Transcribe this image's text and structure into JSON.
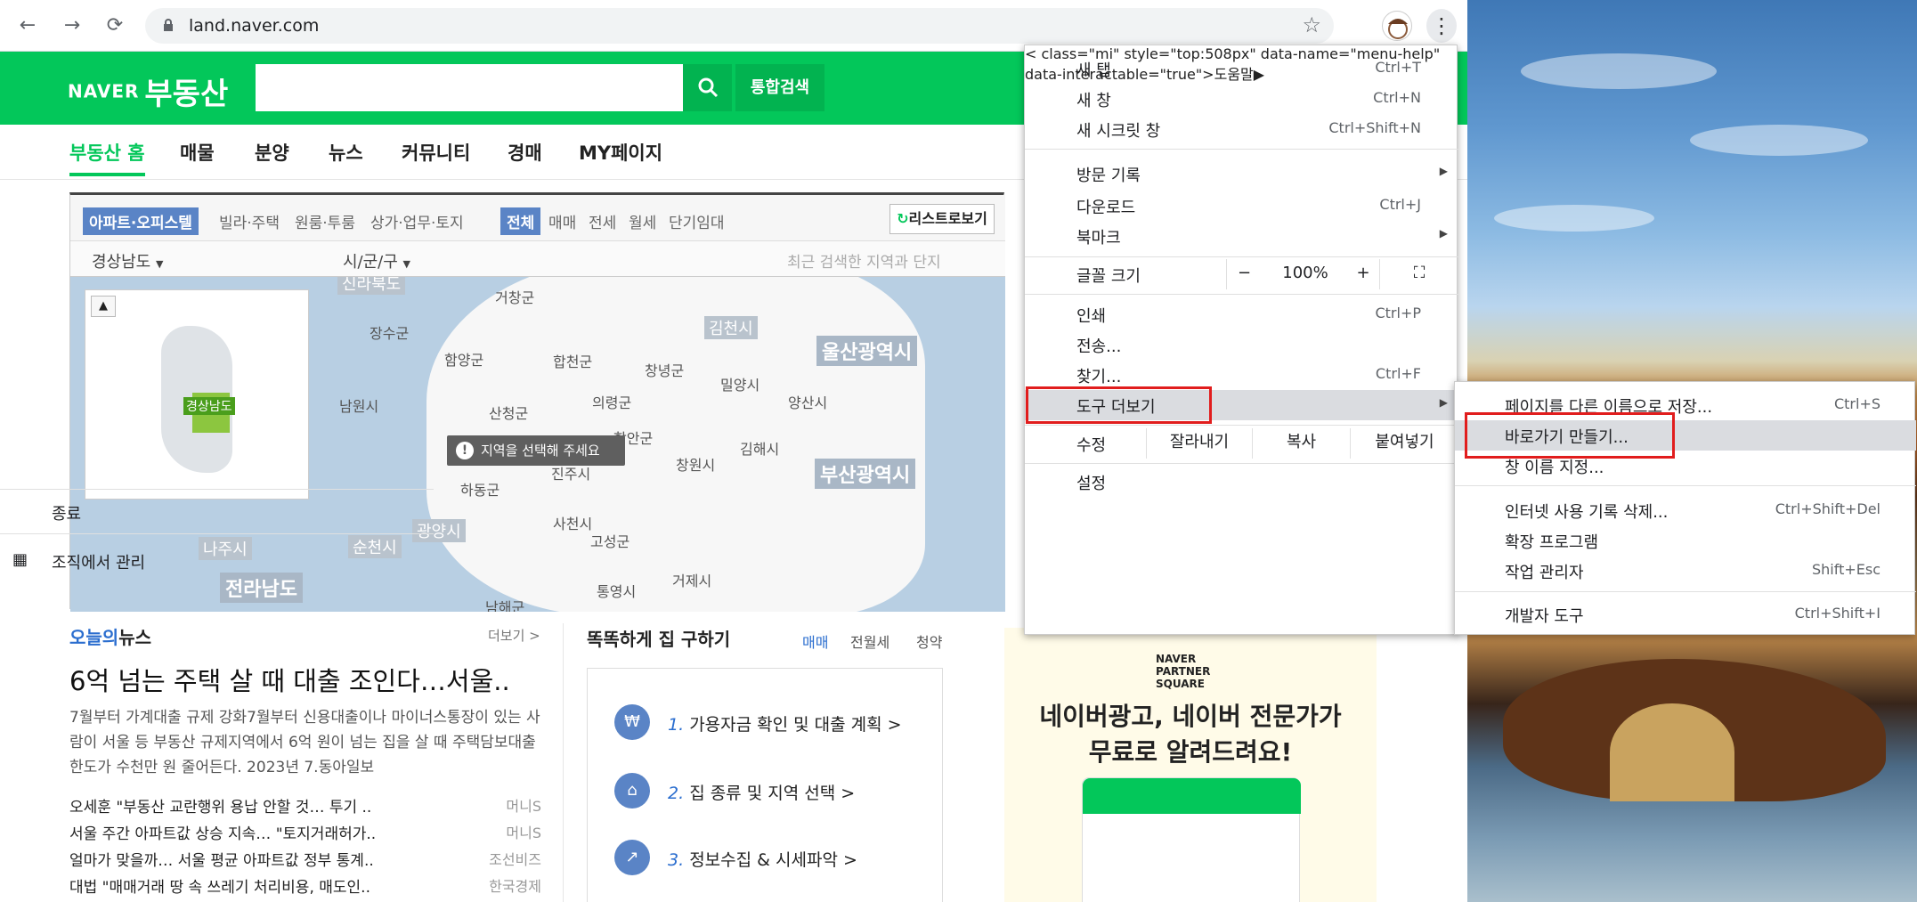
{
  "browser": {
    "url": "land.naver.com",
    "nav_back_icon": "arrow-left-icon",
    "nav_forward_icon": "arrow-right-icon",
    "reload_icon": "reload-icon"
  },
  "naver": {
    "logo_prefix": "NAVER",
    "logo_title": "부동산",
    "search_button": "통합검색",
    "nav": [
      "부동산 홈",
      "매물",
      "분양",
      "뉴스",
      "커뮤니티",
      "경매",
      "MY페이지"
    ]
  },
  "map": {
    "property_tabs": [
      "아파트·오피스텔",
      "빌라·주택",
      "원룸·투룸",
      "상가·업무·토지"
    ],
    "deal_tabs": [
      "전체",
      "매매",
      "전세",
      "월세",
      "단기임대"
    ],
    "list_button": "리스트로보기",
    "region_select": "경상남도",
    "city_select": "시/군/구",
    "recent_placeholder": "최근 검색한 지역과 단지",
    "minimap_tag": "경상남도",
    "notice": "지역을 선택해 주세요",
    "labels": [
      "거창군",
      "장수군",
      "함양군",
      "합천군",
      "창녕군",
      "밀양시",
      "남원시",
      "산청군",
      "의령군",
      "함안군",
      "양산시",
      "김해시",
      "창원시",
      "진주시",
      "하동군",
      "사천시",
      "고성군",
      "나주시",
      "순천시",
      "광양시",
      "통영시",
      "거제시",
      "남해군",
      "김천시"
    ],
    "provinces": [
      "울산광역시",
      "부산광역시",
      "전라남도"
    ],
    "provinces_small": [
      "신라북도"
    ]
  },
  "news": {
    "title_accent": "오늘의",
    "title_rest": "뉴스",
    "more": "더보기 >",
    "headline": "6억 넘는 주택 살 때 대출 조인다…서울..",
    "summary": "7월부터 가계대출 규제 강화7월부터 신용대출이나 마이너스통장이 있는 사람이 서울 등 부동산 규제지역에서 6억 원이 넘는 집을 살 때 주택담보대출 한도가 수천만 원 줄어든다. 2023년 7.동아일보",
    "items": [
      {
        "text": "오세훈 \"부동산 교란행위 용납 안할 것… 투기 ..",
        "source": "머니S"
      },
      {
        "text": "서울 주간 아파트값 상승 지속… \"토지거래허가..",
        "source": "머니S"
      },
      {
        "text": "얼마가 맞을까… 서울 평균 아파트값 정부 통계..",
        "source": "조선비즈"
      },
      {
        "text": "대법 \"매매거래 땅 속 쓰레기 처리비용, 매도인..",
        "source": "한국경제"
      }
    ]
  },
  "house": {
    "title": "똑똑하게 집 구하기",
    "tabs": [
      "매매",
      "전월세",
      "청약"
    ],
    "steps": [
      {
        "num": "1.",
        "text": "가용자금 확인 및 대출 계획 >"
      },
      {
        "num": "2.",
        "text": "집 종류 및 지역 선택 >"
      },
      {
        "num": "3.",
        "text": "정보수집 & 시세파악 >"
      }
    ]
  },
  "ad": {
    "logo": "NAVER PARTNER SQUARE",
    "line1": "네이버광고, 네이버 전문가가",
    "line2": "무료로 알려드려요!"
  },
  "menu": {
    "new_tab": {
      "label": "새 탭",
      "shortcut": "Ctrl+T"
    },
    "new_window": {
      "label": "새 창",
      "shortcut": "Ctrl+N"
    },
    "incognito": {
      "label": "새 시크릿 창",
      "shortcut": "Ctrl+Shift+N"
    },
    "history": {
      "label": "방문 기록"
    },
    "downloads": {
      "label": "다운로드",
      "shortcut": "Ctrl+J"
    },
    "bookmarks": {
      "label": "북마크"
    },
    "zoom": {
      "label": "글꼴 크기",
      "minus": "−",
      "value": "100%",
      "plus": "+"
    },
    "print": {
      "label": "인쇄",
      "shortcut": "Ctrl+P"
    },
    "cast": {
      "label": "전송..."
    },
    "find": {
      "label": "찾기...",
      "shortcut": "Ctrl+F"
    },
    "more_tools": {
      "label": "도구 더보기"
    },
    "edit": {
      "label": "수정",
      "cut": "잘라내기",
      "copy": "복사",
      "paste": "붙여넣기"
    },
    "settings": {
      "label": "설정"
    },
    "help": {
      "label": "도움말"
    },
    "exit": {
      "label": "종료"
    },
    "managed": {
      "label": "조직에서 관리"
    }
  },
  "submenu": {
    "save_page": {
      "label": "페이지를 다른 이름으로 저장...",
      "shortcut": "Ctrl+S"
    },
    "create_shortcut": {
      "label": "바로가기 만들기..."
    },
    "name_window": {
      "label": "창 이름 지정..."
    },
    "clear_data": {
      "label": "인터넷 사용 기록 삭제...",
      "shortcut": "Ctrl+Shift+Del"
    },
    "extensions": {
      "label": "확장 프로그램"
    },
    "task_manager": {
      "label": "작업 관리자",
      "shortcut": "Shift+Esc"
    },
    "dev_tools": {
      "label": "개발자 도구",
      "shortcut": "Ctrl+Shift+I"
    }
  },
  "colors": {
    "naver_green": "#03c75a",
    "highlight": "#e11d1d",
    "menu_hover": "#dadce0"
  }
}
